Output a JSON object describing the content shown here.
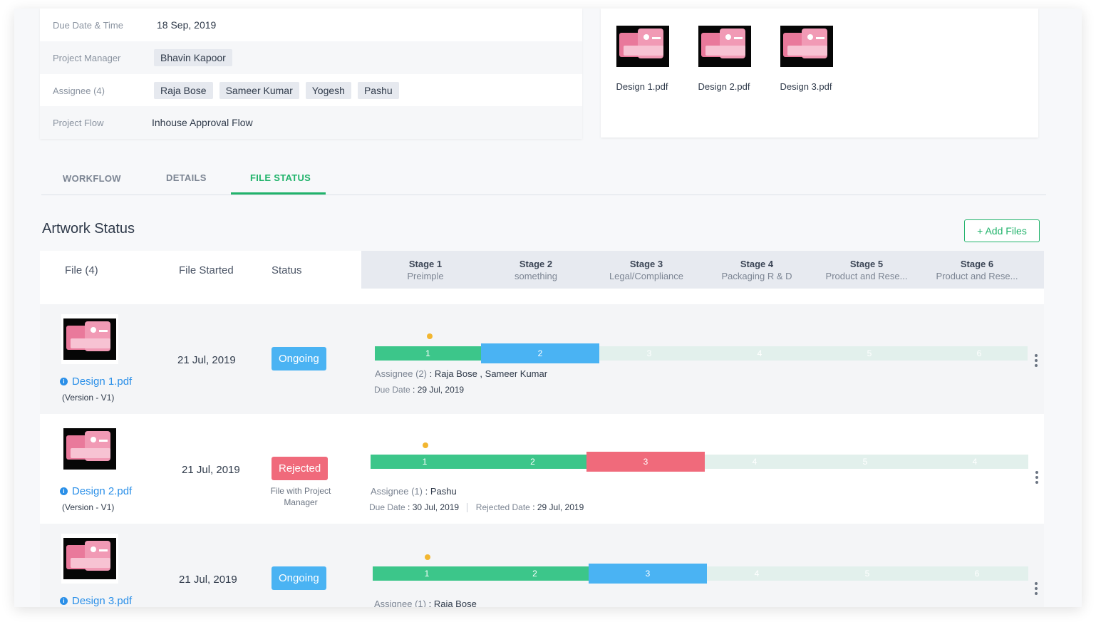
{
  "project": {
    "due_label": "Due Date & Time",
    "due_value": "18 Sep, 2019",
    "manager_label": "Project Manager",
    "manager": "Bhavin Kapoor",
    "assignee_label": "Assignee (4)",
    "assignees": [
      "Raja Bose",
      "Sameer Kumar",
      "Yogesh",
      "Pashu"
    ],
    "flow_label": "Project Flow",
    "flow_value": "Inhouse Approval Flow"
  },
  "files": [
    "Design 1.pdf",
    "Design 2.pdf",
    "Design 3.pdf"
  ],
  "tabs": [
    "WORKFLOW",
    "DETAILS",
    "FILE STATUS"
  ],
  "active_tab": "FILE STATUS",
  "section_title": "Artwork Status",
  "add_files_label": "+ Add Files",
  "table": {
    "col_file": "File (4)",
    "col_started": "File Started",
    "col_status": "Status",
    "stages": [
      {
        "name": "Stage 1",
        "sub": "Preimple"
      },
      {
        "name": "Stage 2",
        "sub": "something"
      },
      {
        "name": "Stage 3",
        "sub": "Legal/Compliance"
      },
      {
        "name": "Stage 4",
        "sub": "Packaging R & D"
      },
      {
        "name": "Stage 5",
        "sub": "Product and Rese..."
      },
      {
        "name": "Stage 6",
        "sub": "Product and Rese..."
      }
    ]
  },
  "rows": [
    {
      "file": "Design 1.pdf",
      "version": "(Version - V1)",
      "started": "21 Jul, 2019",
      "status": "Ongoing",
      "segments": [
        "1",
        "2",
        "3",
        "4",
        "5",
        "6"
      ],
      "assignee_label": "Assignee (2)",
      "assignee_value": ": Raja Bose , Sameer Kumar",
      "due_label": "Due Date",
      "due_value": ": 29 Jul, 2019"
    },
    {
      "file": "Design 2.pdf",
      "version": "(Version - V1)",
      "started": "21 Jul, 2019",
      "status": "Rejected",
      "status_note": "File with Project Manager",
      "segments": [
        "1",
        "2",
        "3",
        "4",
        "5",
        "4"
      ],
      "assignee_label": "Assignee (1)",
      "assignee_value": ": Pashu",
      "due_label": "Due Date",
      "due_value": ": 30 Jul, 2019",
      "rejected_label": "Rejected Date",
      "rejected_value": ": 29 Jul, 2019"
    },
    {
      "file": "Design 3.pdf",
      "started": "21 Jul, 2019",
      "status": "Ongoing",
      "segments": [
        "1",
        "2",
        "3",
        "4",
        "5",
        "6"
      ],
      "assignee_label": "Assignee (1)",
      "assignee_value": ": Raja Bose"
    }
  ],
  "colors": {
    "accent": "#21b36b",
    "done": "#3cc68a",
    "ongoing": "#4ab3f3",
    "rejected": "#f06a7b",
    "link": "#2a8fe8"
  }
}
